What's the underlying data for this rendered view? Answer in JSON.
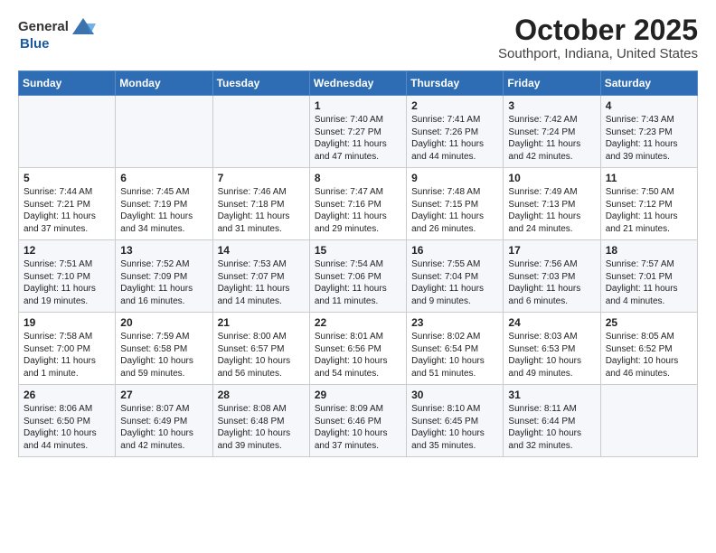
{
  "logo": {
    "general": "General",
    "blue": "Blue"
  },
  "title": "October 2025",
  "subtitle": "Southport, Indiana, United States",
  "days_of_week": [
    "Sunday",
    "Monday",
    "Tuesday",
    "Wednesday",
    "Thursday",
    "Friday",
    "Saturday"
  ],
  "weeks": [
    [
      {
        "day": "",
        "info": ""
      },
      {
        "day": "",
        "info": ""
      },
      {
        "day": "",
        "info": ""
      },
      {
        "day": "1",
        "info": "Sunrise: 7:40 AM\nSunset: 7:27 PM\nDaylight: 11 hours and 47 minutes."
      },
      {
        "day": "2",
        "info": "Sunrise: 7:41 AM\nSunset: 7:26 PM\nDaylight: 11 hours and 44 minutes."
      },
      {
        "day": "3",
        "info": "Sunrise: 7:42 AM\nSunset: 7:24 PM\nDaylight: 11 hours and 42 minutes."
      },
      {
        "day": "4",
        "info": "Sunrise: 7:43 AM\nSunset: 7:23 PM\nDaylight: 11 hours and 39 minutes."
      }
    ],
    [
      {
        "day": "5",
        "info": "Sunrise: 7:44 AM\nSunset: 7:21 PM\nDaylight: 11 hours and 37 minutes."
      },
      {
        "day": "6",
        "info": "Sunrise: 7:45 AM\nSunset: 7:19 PM\nDaylight: 11 hours and 34 minutes."
      },
      {
        "day": "7",
        "info": "Sunrise: 7:46 AM\nSunset: 7:18 PM\nDaylight: 11 hours and 31 minutes."
      },
      {
        "day": "8",
        "info": "Sunrise: 7:47 AM\nSunset: 7:16 PM\nDaylight: 11 hours and 29 minutes."
      },
      {
        "day": "9",
        "info": "Sunrise: 7:48 AM\nSunset: 7:15 PM\nDaylight: 11 hours and 26 minutes."
      },
      {
        "day": "10",
        "info": "Sunrise: 7:49 AM\nSunset: 7:13 PM\nDaylight: 11 hours and 24 minutes."
      },
      {
        "day": "11",
        "info": "Sunrise: 7:50 AM\nSunset: 7:12 PM\nDaylight: 11 hours and 21 minutes."
      }
    ],
    [
      {
        "day": "12",
        "info": "Sunrise: 7:51 AM\nSunset: 7:10 PM\nDaylight: 11 hours and 19 minutes."
      },
      {
        "day": "13",
        "info": "Sunrise: 7:52 AM\nSunset: 7:09 PM\nDaylight: 11 hours and 16 minutes."
      },
      {
        "day": "14",
        "info": "Sunrise: 7:53 AM\nSunset: 7:07 PM\nDaylight: 11 hours and 14 minutes."
      },
      {
        "day": "15",
        "info": "Sunrise: 7:54 AM\nSunset: 7:06 PM\nDaylight: 11 hours and 11 minutes."
      },
      {
        "day": "16",
        "info": "Sunrise: 7:55 AM\nSunset: 7:04 PM\nDaylight: 11 hours and 9 minutes."
      },
      {
        "day": "17",
        "info": "Sunrise: 7:56 AM\nSunset: 7:03 PM\nDaylight: 11 hours and 6 minutes."
      },
      {
        "day": "18",
        "info": "Sunrise: 7:57 AM\nSunset: 7:01 PM\nDaylight: 11 hours and 4 minutes."
      }
    ],
    [
      {
        "day": "19",
        "info": "Sunrise: 7:58 AM\nSunset: 7:00 PM\nDaylight: 11 hours and 1 minute."
      },
      {
        "day": "20",
        "info": "Sunrise: 7:59 AM\nSunset: 6:58 PM\nDaylight: 10 hours and 59 minutes."
      },
      {
        "day": "21",
        "info": "Sunrise: 8:00 AM\nSunset: 6:57 PM\nDaylight: 10 hours and 56 minutes."
      },
      {
        "day": "22",
        "info": "Sunrise: 8:01 AM\nSunset: 6:56 PM\nDaylight: 10 hours and 54 minutes."
      },
      {
        "day": "23",
        "info": "Sunrise: 8:02 AM\nSunset: 6:54 PM\nDaylight: 10 hours and 51 minutes."
      },
      {
        "day": "24",
        "info": "Sunrise: 8:03 AM\nSunset: 6:53 PM\nDaylight: 10 hours and 49 minutes."
      },
      {
        "day": "25",
        "info": "Sunrise: 8:05 AM\nSunset: 6:52 PM\nDaylight: 10 hours and 46 minutes."
      }
    ],
    [
      {
        "day": "26",
        "info": "Sunrise: 8:06 AM\nSunset: 6:50 PM\nDaylight: 10 hours and 44 minutes."
      },
      {
        "day": "27",
        "info": "Sunrise: 8:07 AM\nSunset: 6:49 PM\nDaylight: 10 hours and 42 minutes."
      },
      {
        "day": "28",
        "info": "Sunrise: 8:08 AM\nSunset: 6:48 PM\nDaylight: 10 hours and 39 minutes."
      },
      {
        "day": "29",
        "info": "Sunrise: 8:09 AM\nSunset: 6:46 PM\nDaylight: 10 hours and 37 minutes."
      },
      {
        "day": "30",
        "info": "Sunrise: 8:10 AM\nSunset: 6:45 PM\nDaylight: 10 hours and 35 minutes."
      },
      {
        "day": "31",
        "info": "Sunrise: 8:11 AM\nSunset: 6:44 PM\nDaylight: 10 hours and 32 minutes."
      },
      {
        "day": "",
        "info": ""
      }
    ]
  ]
}
